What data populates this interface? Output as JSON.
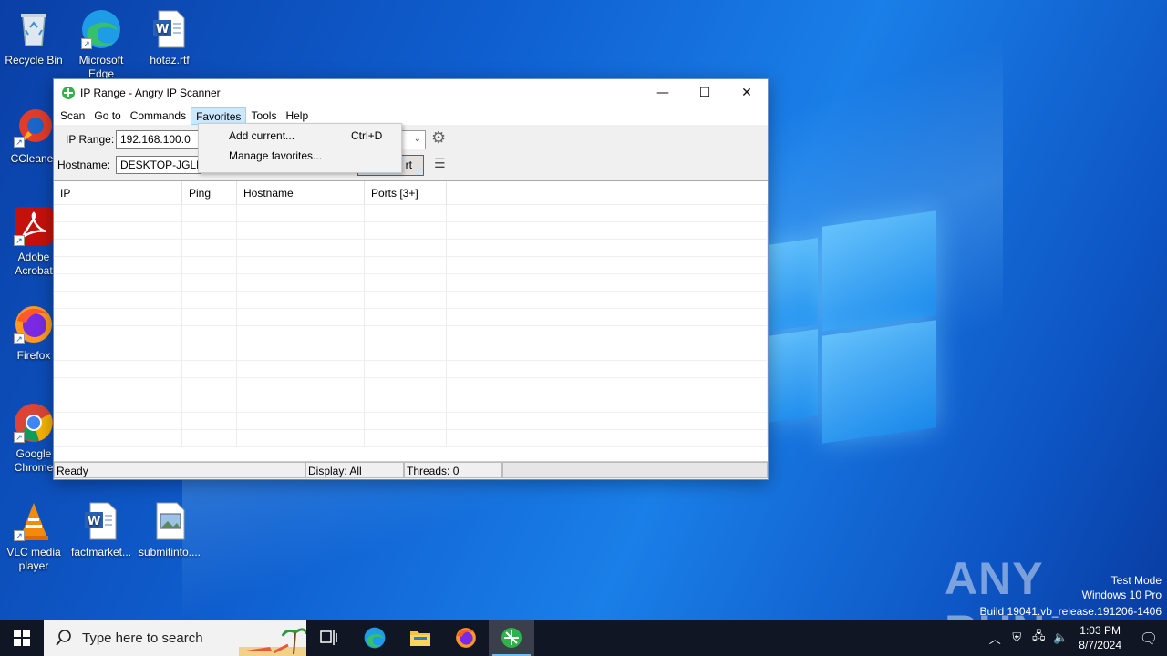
{
  "desktop": {
    "icons": [
      {
        "label": "Recycle Bin"
      },
      {
        "label": "Microsoft Edge"
      },
      {
        "label": "hotaz.rtf"
      },
      {
        "label": "CCleaner"
      },
      {
        "label": "Adobe Acrobat"
      },
      {
        "label": "Firefox"
      },
      {
        "label": "Google Chrome"
      },
      {
        "label": "VLC media player"
      },
      {
        "label": "factmarket..."
      },
      {
        "label": "submitinto...."
      }
    ]
  },
  "window": {
    "title": "IP Range - Angry IP Scanner",
    "controls": {
      "minimize": "—",
      "maximize": "☐",
      "close": "✕"
    },
    "menu": [
      "Scan",
      "Go to",
      "Commands",
      "Favorites",
      "Tools",
      "Help"
    ],
    "toolbar": {
      "ip_range_label": "IP Range:",
      "ip_range_value": "192.168.100.0",
      "hostname_label": "Hostname:",
      "hostname_value": "DESKTOP-JGLLJI",
      "start_button": "rt"
    },
    "favorites_menu": [
      {
        "label": "Add current...",
        "shortcut": "Ctrl+D"
      },
      {
        "label": "Manage favorites...",
        "shortcut": ""
      }
    ],
    "columns": [
      "IP",
      "Ping",
      "Hostname",
      "Ports [3+]"
    ],
    "status": {
      "state": "Ready",
      "display": "Display: All",
      "threads": "Threads: 0"
    }
  },
  "watermark": {
    "brand": "ANY RUN",
    "line1": "Test Mode",
    "line2": "Windows 10 Pro",
    "line3": "Build 19041.vb_release.191206-1406"
  },
  "taskbar": {
    "search_placeholder": "Type here to search",
    "time": "1:03 PM",
    "date": "8/7/2024"
  },
  "colors": {
    "accent": "#0078d7",
    "menu_highlight": "#cce8ff",
    "taskbar": "#101624"
  }
}
